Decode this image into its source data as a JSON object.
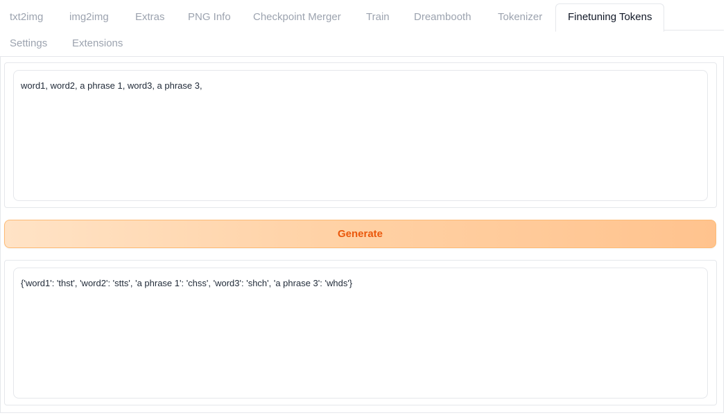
{
  "tabs": [
    {
      "label": "txt2img"
    },
    {
      "label": "img2img"
    },
    {
      "label": "Extras"
    },
    {
      "label": "PNG Info"
    },
    {
      "label": "Checkpoint Merger"
    },
    {
      "label": "Train"
    },
    {
      "label": "Dreambooth"
    },
    {
      "label": "Tokenizer"
    },
    {
      "label": "Finetuning Tokens",
      "active": true
    },
    {
      "label": "Settings"
    },
    {
      "label": "Extensions"
    }
  ],
  "input": {
    "value": "word1, word2, a phrase 1, word3, a phrase 3,"
  },
  "generate": {
    "label": "Generate"
  },
  "output": {
    "value": "{'word1': 'thst', 'word2': 'stts', 'a phrase 1': 'chss', 'word3': 'shch', 'a phrase 3': 'whds'}"
  },
  "colors": {
    "accent": "#ea580c",
    "button_gradient_start": "#ffe3c6",
    "button_gradient_end": "#ffc38e",
    "border": "#e5e7eb"
  }
}
